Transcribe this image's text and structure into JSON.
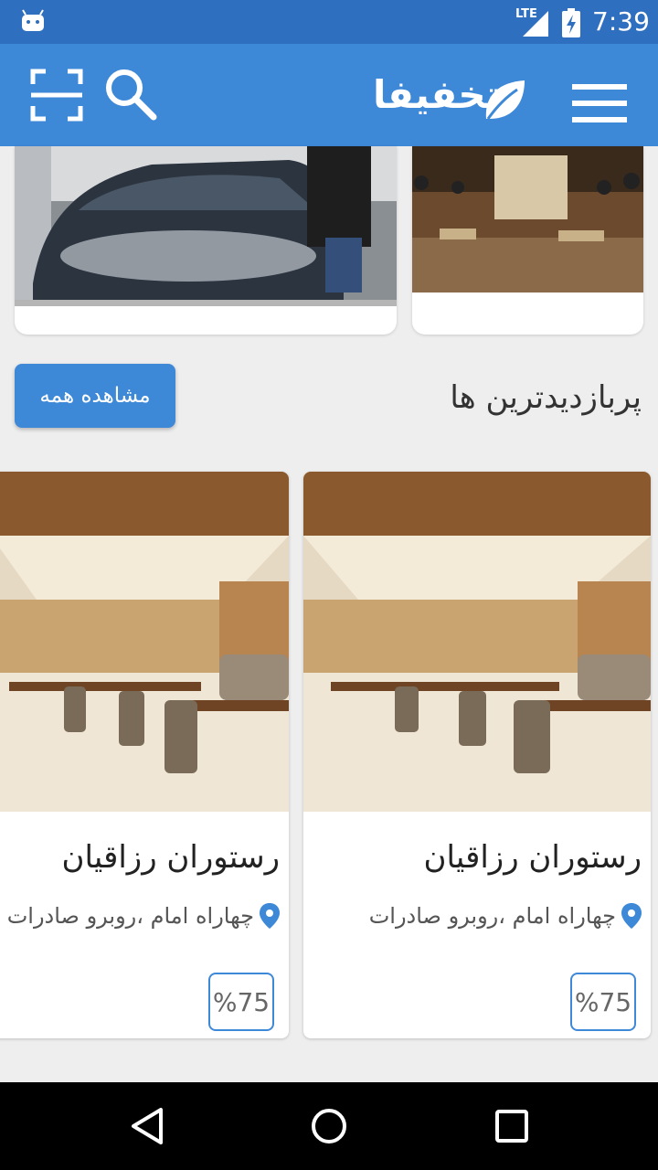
{
  "status_bar": {
    "time": "7:39",
    "network": "LTE",
    "icons": [
      "android-icon",
      "lte-signal-icon",
      "battery-charging-icon"
    ]
  },
  "app_bar": {
    "title": "تخفیفا",
    "icons": [
      "menu-icon",
      "leaf-logo-icon",
      "search-icon",
      "scan-icon"
    ]
  },
  "top_cards": [
    {
      "image": "car-wash-photo"
    },
    {
      "image": "cafe-interior-photo"
    }
  ],
  "section": {
    "title": "پربازدیدترین ها",
    "see_all_label": "مشاهده همه"
  },
  "products": [
    {
      "name": "رستوران رزاقیان",
      "location": "چهاراه امام ،روبرو صادرات",
      "discount": "%75",
      "icon": "location-pin-icon"
    },
    {
      "name": "رستوران رزاقیان",
      "location": "چهاراه امام ،روبرو صادرات",
      "discount": "%75",
      "icon": "location-pin-icon"
    }
  ],
  "colors": {
    "status_bar": "#2f6fbf",
    "app_bar": "#3e88d8",
    "accent": "#3e88d8",
    "background": "#eeeeee"
  }
}
